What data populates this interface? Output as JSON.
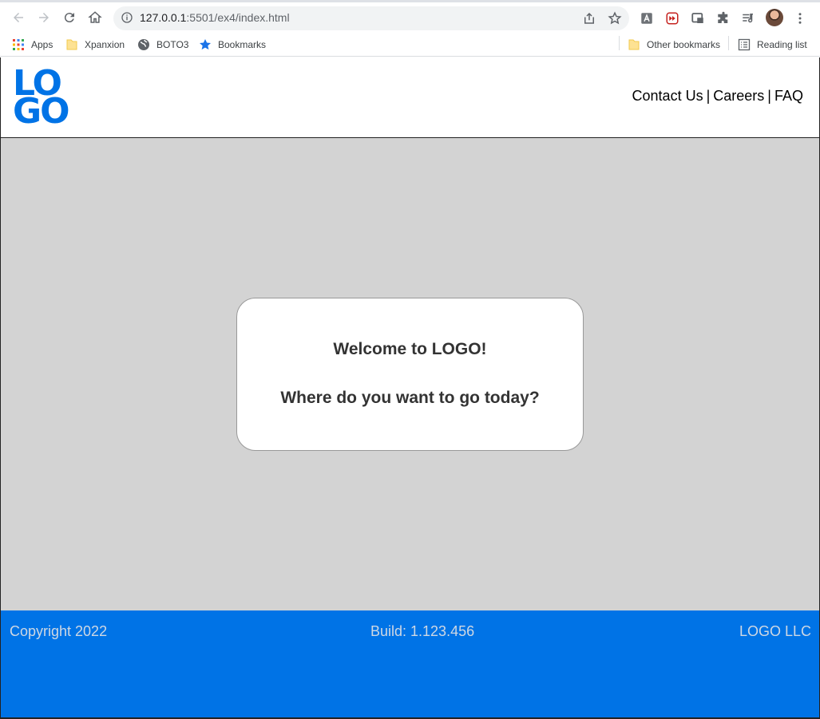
{
  "browser": {
    "url_host": "127.0.0.1",
    "url_rest": ":5501/ex4/index.html",
    "bookmarks": [
      {
        "label": "Apps",
        "icon": "apps-grid-icon"
      },
      {
        "label": "Xpanxion",
        "icon": "folder-icon"
      },
      {
        "label": "BOTO3",
        "icon": "globe-icon"
      },
      {
        "label": "Bookmarks",
        "icon": "star-icon"
      }
    ],
    "other_bookmarks": "Other bookmarks",
    "reading_list": "Reading list"
  },
  "header": {
    "logo_line1": "LO",
    "logo_line2": "GO",
    "nav": [
      {
        "label": "Contact Us"
      },
      {
        "label": "Careers"
      },
      {
        "label": "FAQ"
      }
    ],
    "separator": "|"
  },
  "main": {
    "welcome": "Welcome to LOGO!",
    "prompt": "Where do you want to go today?"
  },
  "footer": {
    "copyright": "Copyright 2022",
    "build": "Build: 1.123.456",
    "company": "LOGO LLC"
  },
  "colors": {
    "brand_blue": "#0073e6",
    "main_bg": "#d3d3d3"
  }
}
